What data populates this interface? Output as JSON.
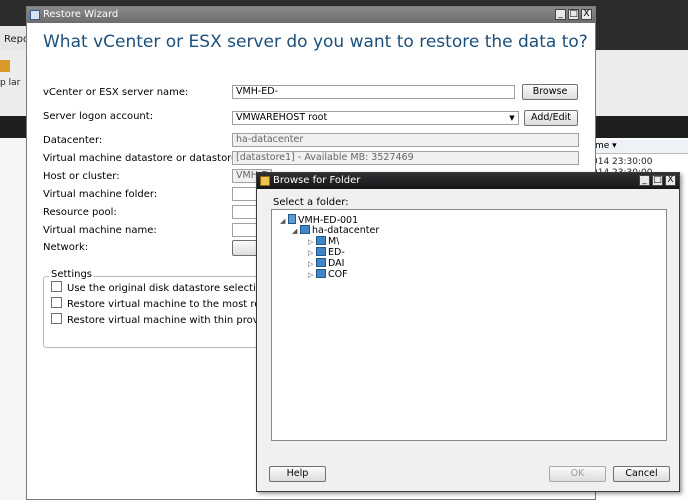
{
  "background_app": {
    "tab_label": "Repo",
    "ribbon_label": "p lar",
    "column_header": "me ▾",
    "rows": [
      "014 23:30:00",
      "014 23:30:00"
    ]
  },
  "wizard": {
    "window_title": "Restore Wizard",
    "heading": "What vCenter or ESX server do you want to restore the data to?",
    "server_name_label": "vCenter or ESX server name:",
    "server_name_value": "VMH-ED-",
    "browse_button": "Browse",
    "logon_label": "Server logon account:",
    "logon_value": "VMWAREHOST root",
    "add_edit_button": "Add/Edit",
    "datacenter_label": "Datacenter:",
    "datacenter_value": "ha-datacenter",
    "datastore_label": "Virtual machine datastore or datastore cluster:",
    "datastore_value": "[datastore1] - Available MB: 3527469",
    "host_label": "Host or cluster:",
    "host_value": "VMH-E",
    "vm_folder_label": "Virtual machine folder:",
    "resource_pool_label": "Resource pool:",
    "vm_name_label": "Virtual machine name:",
    "network_label": "Network:",
    "settings_legend": "Settings",
    "settings": [
      "Use the original disk datastore selections if avail",
      "Restore virtual machine to the most recent hard",
      "Restore virtual machine with thin provisioning"
    ]
  },
  "browse_dialog": {
    "window_title": "Browse for Folder",
    "prompt": "Select a folder:",
    "tree": {
      "root": "VMH-ED-001",
      "datacenter": "ha-datacenter",
      "children": [
        "M\\",
        "ED-",
        "DAI",
        "COF"
      ]
    },
    "help_button": "Help",
    "ok_button": "OK",
    "cancel_button": "Cancel"
  },
  "window_controls": {
    "minimize": "_",
    "maximize": "□",
    "close": "X"
  }
}
